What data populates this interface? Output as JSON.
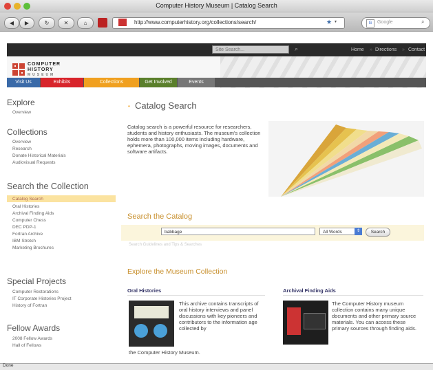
{
  "window": {
    "title": "Computer History Museum | Catalog Search"
  },
  "toolbar": {
    "url": "http://www.computerhistory.org/collections/search/",
    "search_placeholder": "Google"
  },
  "header": {
    "search_placeholder": "Site Search...",
    "links": [
      "Home",
      "Directions",
      "Contact"
    ],
    "logo": {
      "line1": "COMPUTER",
      "line2": "HISTORY",
      "line3": "MUSEUM"
    },
    "nav": [
      "Visit Us",
      "Exhibits",
      "Collections",
      "Get Involved",
      "Events"
    ]
  },
  "sidebar": {
    "sections": [
      {
        "heading": "Explore",
        "items": [
          "Overview"
        ]
      },
      {
        "heading": "Collections",
        "items": [
          "Overview",
          "Research",
          "Donate Historical Materials",
          "Audiovisual Requests"
        ]
      },
      {
        "heading": "Search the Collection",
        "items": [
          "Catalog Search",
          "Oral Histories",
          "Archival Finding Aids",
          "Computer Chess",
          "DEC PDP-1",
          "Fortran Archive",
          "IBM Stretch",
          "Marketing Brochures"
        ]
      },
      {
        "heading": "Special Projects",
        "items": [
          "Computer Restorations",
          "IT Corporate Histories Project",
          "History of Fortran"
        ]
      },
      {
        "heading": "Fellow Awards",
        "items": [
          "2008 Fellow Awards",
          "Hall of Fellows"
        ]
      }
    ]
  },
  "main": {
    "title": "Catalog Search",
    "intro": "Catalog search is a powerful resource for researchers, students and history enthusiasts. The museum's collection holds more than 100,000 items including hardware, ephemera, photographs, moving images, documents and software artifacts.",
    "search_heading": "Search the Catalog",
    "search_value": "babbage",
    "select_value": "All Words",
    "search_button": "Search",
    "advanced_link": "Search Guidelines and Tips & Searches",
    "explore_heading": "Explore the Museum Collection",
    "oral": {
      "heading": "Oral Histories",
      "text": "This archive contains transcripts of oral history interviews and panel discussions with key pioneers and contributors to the information age collected by",
      "tail": "the Computer History Museum."
    },
    "archival": {
      "heading": "Archival Finding Aids",
      "text": "The Computer History museum collection contains many unique documents and other primary source materials. You can access these primary sources through finding aids."
    }
  },
  "status": {
    "text": "Done"
  },
  "colors": {
    "accent": "#c8902e",
    "nav_active": "#f0a020",
    "nav_exhibits": "#d8242b",
    "nav_involved": "#5a7f2b",
    "nav_visit": "#3a6aa8"
  }
}
